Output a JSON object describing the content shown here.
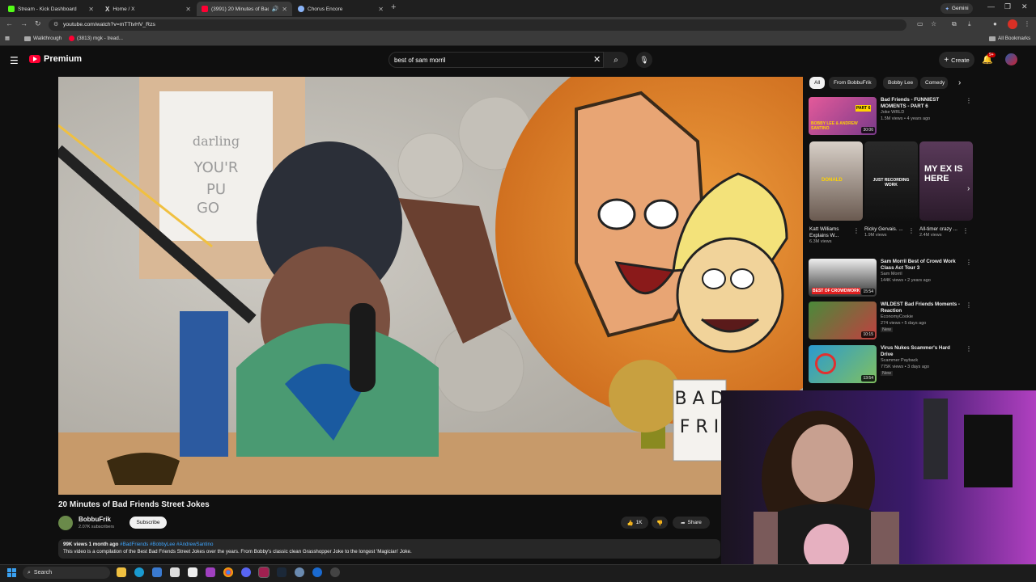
{
  "browser": {
    "tabs": [
      {
        "label": "Stream - Kick Dashboard",
        "color": "#53fc18"
      },
      {
        "label": "Home / X",
        "color": "#ffffff"
      },
      {
        "label": "(3991) 20 Minutes of Bad F",
        "color": "#ff0033",
        "active": true
      },
      {
        "label": "Chorus Encore",
        "color": "#8ab4f8"
      }
    ],
    "new_tab": "+",
    "gemini_label": "Gemini",
    "url": "youtube.com/watch?v=mTTtvHV_Rzs",
    "bookmarks": [
      {
        "label": "Walkthrough"
      },
      {
        "label": "(3813) mgk - tread..."
      }
    ],
    "all_bookmarks": "All Bookmarks"
  },
  "youtube": {
    "logo_text": "Premium",
    "search_value": "best of sam morril",
    "create_label": "Create",
    "notif_count": "9+",
    "video": {
      "title": "20 Minutes of Bad Friends Street Jokes",
      "channel": "BobbuFrik",
      "subscribers": "2.07K subscribers",
      "subscribe_label": "Subscribe",
      "likes": "1K",
      "share_label": "Share",
      "desc_stats": "99K views  1 month ago",
      "desc_tags": "#BadFriends #BobbyLee #AndrewSantino",
      "desc_text": "This video is a compilation of the Best Bad Friends Street Jokes over the years. From Bobby's classic clean Grasshopper Joke to the longest 'Magician' Joke.",
      "poster_text_1": "darling",
      "poster_text_2": "YOU'R",
      "poster_text_3": "PU",
      "poster_text_4": "GO",
      "card_text_1": "B A D",
      "card_text_2": "F R I"
    },
    "chips": [
      "All",
      "From BobbuFrik",
      "Bobby Lee",
      "Comedy"
    ],
    "recommendations_top": {
      "title": "Bad Friends - FUNNIEST MOMENTS - PART 6",
      "channel": "Joke WRLD",
      "meta": "1.5M views • 4 years ago",
      "duration": "30:06",
      "thumb_text": "BOBBY LEE & ANDREW SANTINO",
      "thumb_badge": "PART 6"
    },
    "shorts": [
      {
        "title": "Katt Williams Explains W...",
        "views": "6.3M views",
        "thumb_text": "DONALD"
      },
      {
        "title": "Ricky Gervais. ...",
        "views": "1.9M views",
        "thumb_text": "JUST RECORDING WORK"
      },
      {
        "title": "All-timer crazy ...",
        "views": "2.4M views",
        "thumb_text": "MY EX IS HERE"
      }
    ],
    "recommendations": [
      {
        "title": "Sam Morril Best of Crowd Work Class Act Tour 3",
        "channel": "Sam Morril",
        "meta": "144K views • 2 years ago",
        "duration": "15:54",
        "thumb_text": "BEST OF CROWDWORK",
        "badge": ""
      },
      {
        "title": "WILDEST Bad Friends Moments - Reaction",
        "channel": "EconomyCookie",
        "meta": "274 views • 5 days ago",
        "duration": "10:15",
        "thumb_text": "",
        "badge": "New"
      },
      {
        "title": "Virus Nukes Scammer's Hard Drive",
        "channel": "Scammer Payback",
        "meta": "775K views • 3 days ago",
        "duration": "13:54",
        "thumb_text": "",
        "badge": "New"
      }
    ]
  },
  "taskbar": {
    "search_label": "Search"
  }
}
